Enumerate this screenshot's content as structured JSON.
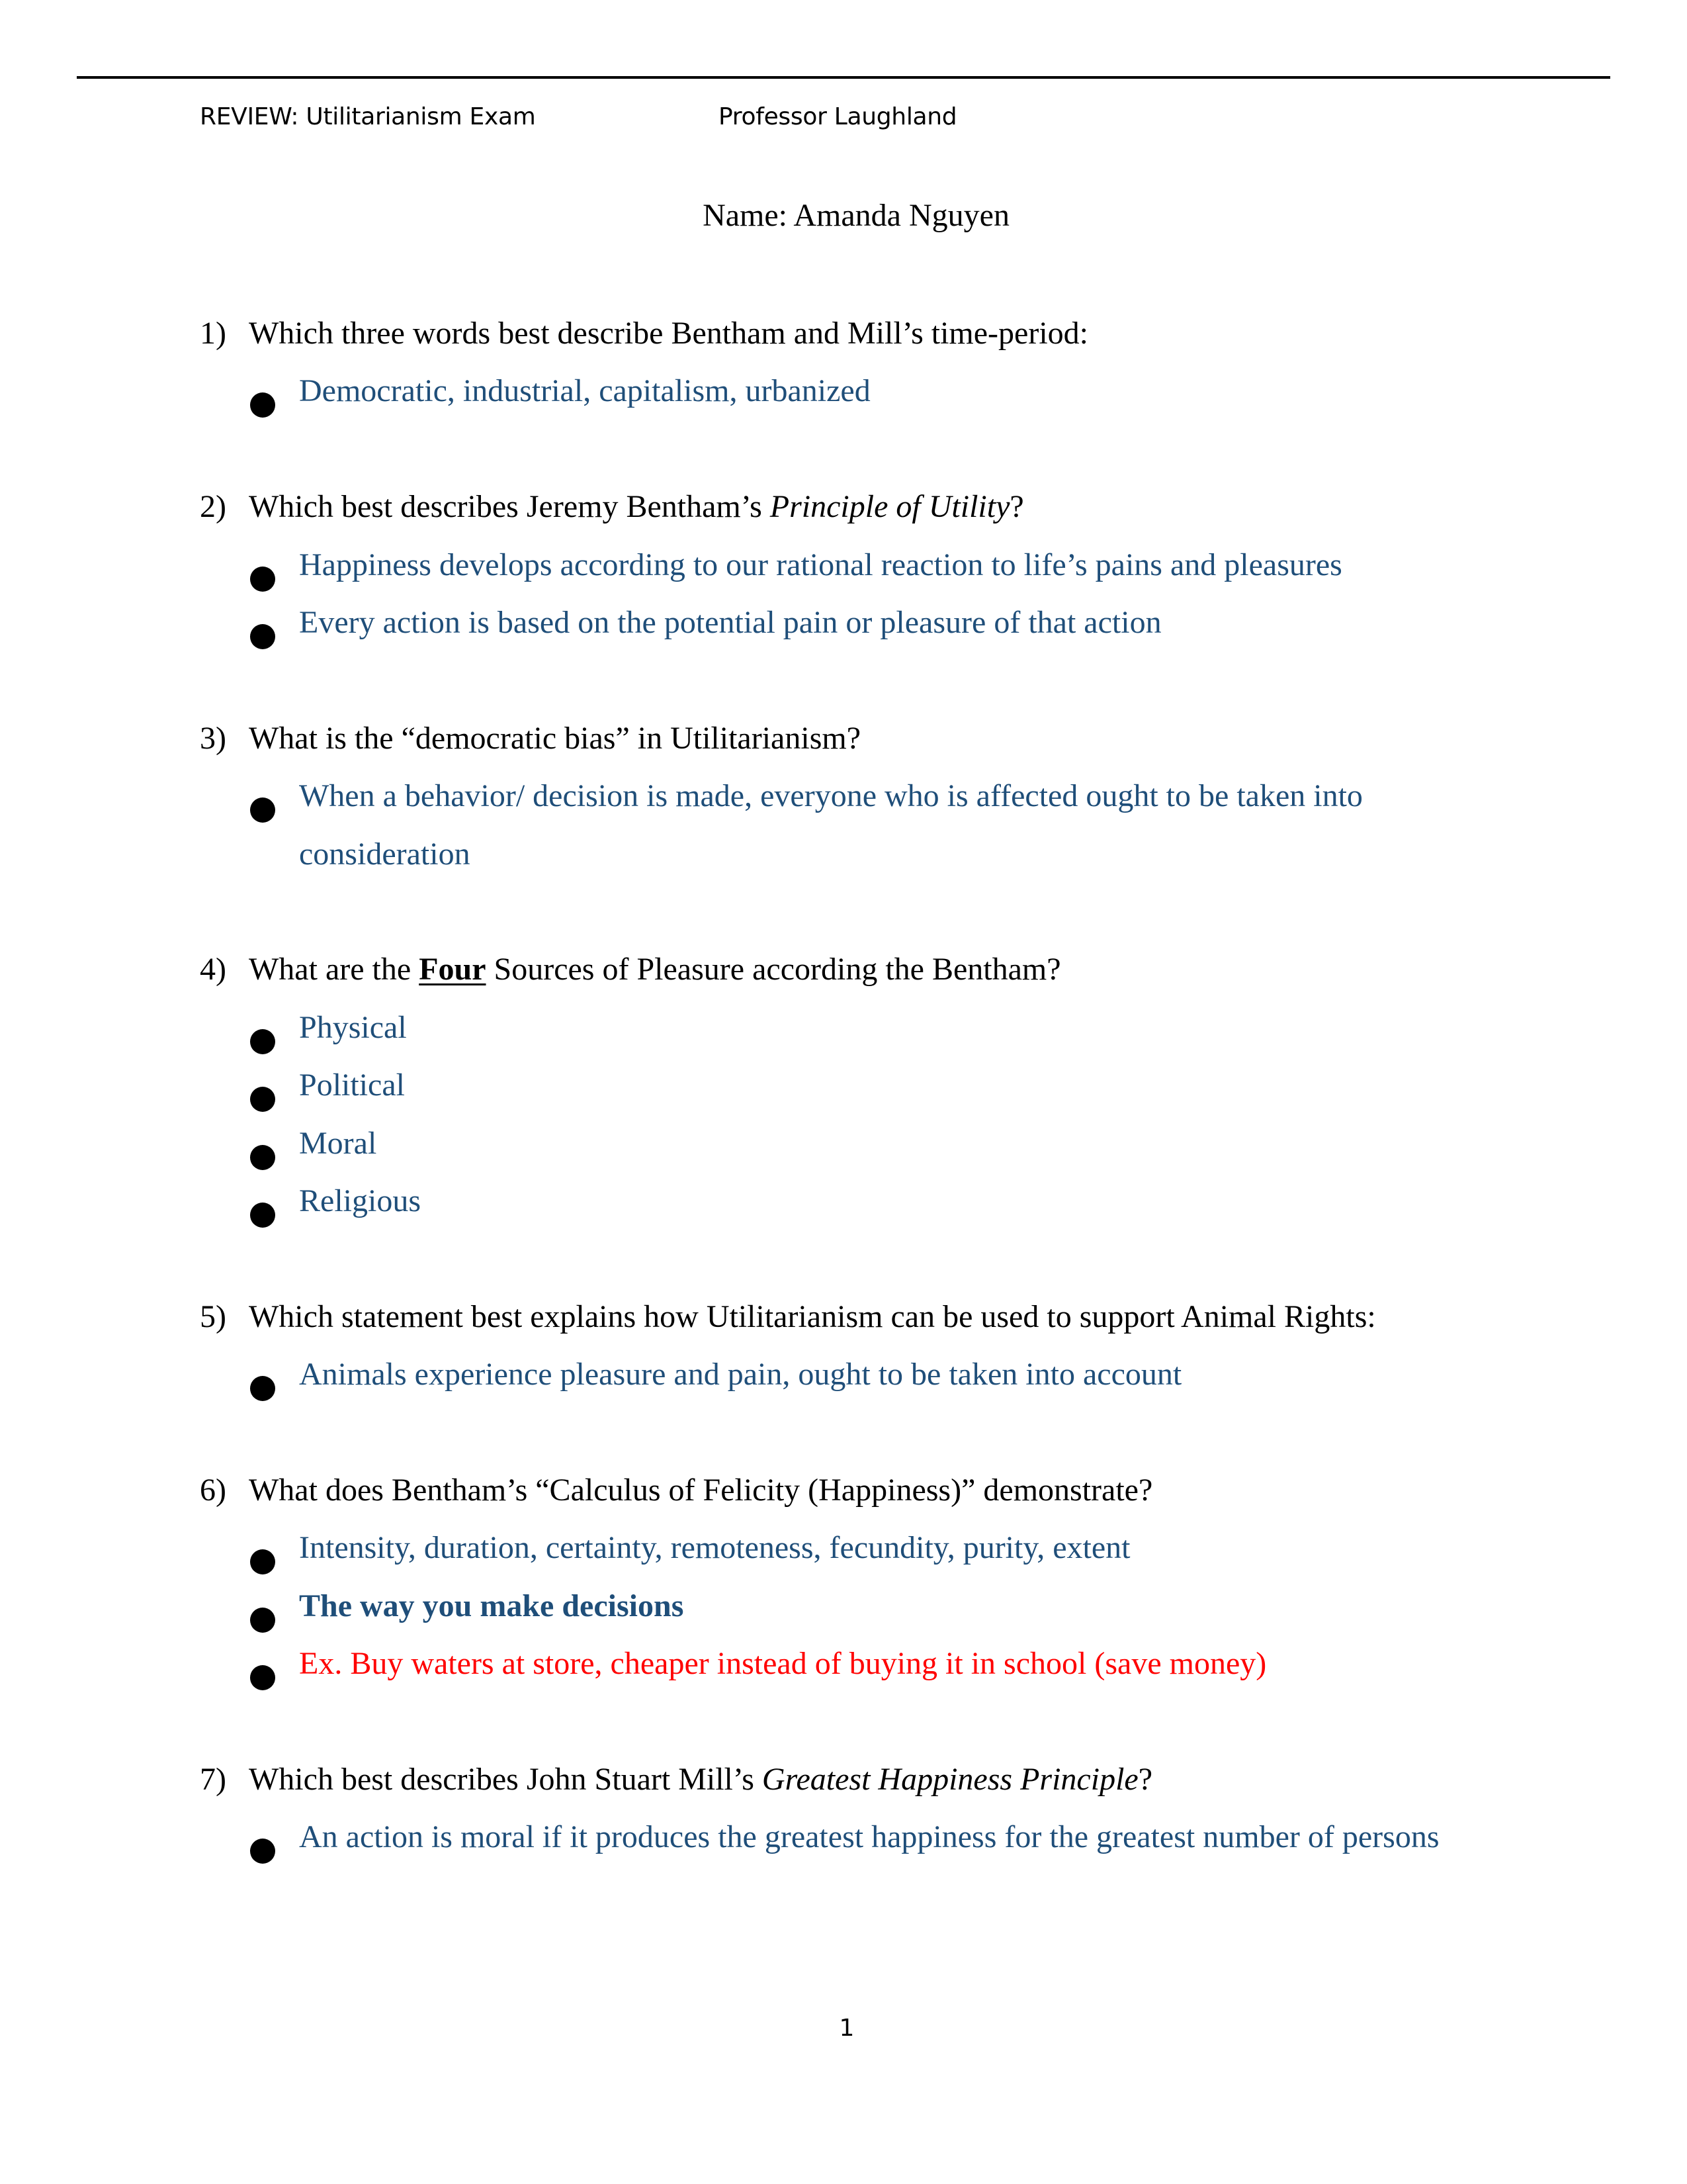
{
  "header": {
    "title": "REVIEW: Utilitarianism Exam",
    "professor": "Professor Laughland"
  },
  "student": {
    "name_line": "Name: Amanda Nguyen"
  },
  "colors": {
    "answer": "#1f4e79",
    "example": "#ff0000",
    "question": "#000000"
  },
  "questions": [
    {
      "number": "1)",
      "text_parts": [
        {
          "text": "Which three words best describe Bentham and Mill’s time-period:",
          "style": "normal"
        }
      ],
      "answers": [
        {
          "text": "Democratic, industrial, capitalism, urbanized",
          "style": "normal"
        }
      ]
    },
    {
      "number": "2)",
      "text_parts": [
        {
          "text": "Which best describes Jeremy Bentham’s ",
          "style": "normal"
        },
        {
          "text": "Principle of Utility",
          "style": "italic"
        },
        {
          "text": "?",
          "style": "normal"
        }
      ],
      "answers": [
        {
          "text": "Happiness develops according to our rational reaction to life’s pains and pleasures",
          "style": "normal"
        },
        {
          "text": "Every action is based on the potential pain or pleasure of that action",
          "style": "normal"
        }
      ]
    },
    {
      "number": "3)",
      "text_parts": [
        {
          "text": "What is the “democratic bias” in Utilitarianism?",
          "style": "normal"
        }
      ],
      "answers": [
        {
          "text": "When a behavior/ decision is made, everyone who is affected ought to be taken into",
          "continuation": "consideration",
          "style": "normal"
        }
      ]
    },
    {
      "number": "4)",
      "text_parts": [
        {
          "text": "What are the ",
          "style": "normal"
        },
        {
          "text": "Four",
          "style": "bold-underline"
        },
        {
          "text": " Sources of Pleasure according the Bentham?",
          "style": "normal"
        }
      ],
      "answers": [
        {
          "text": "Physical",
          "style": "normal"
        },
        {
          "text": "Political",
          "style": "normal"
        },
        {
          "text": "Moral",
          "style": "normal"
        },
        {
          "text": "Religious",
          "style": "normal"
        }
      ]
    },
    {
      "number": "5)",
      "text_parts": [
        {
          "text": "Which statement best explains how Utilitarianism can be used to support Animal Rights:",
          "style": "normal"
        }
      ],
      "answers": [
        {
          "text": "Animals experience pleasure and pain, ought to be taken into account",
          "style": "normal"
        }
      ]
    },
    {
      "number": "6)",
      "text_parts": [
        {
          "text": "What does Bentham’s  “Calculus of Felicity (Happiness)” demonstrate?",
          "style": "normal"
        }
      ],
      "answers": [
        {
          "text": "Intensity, duration, certainty, remoteness, fecundity, purity, extent",
          "style": "normal"
        },
        {
          "text": "The way you make decisions",
          "style": "bold"
        },
        {
          "text": "Ex. Buy waters at store, cheaper instead of buying it in school (save money)",
          "style": "red"
        }
      ]
    },
    {
      "number": "7)",
      "text_parts": [
        {
          "text": "Which best describes John Stuart Mill’s ",
          "style": "normal"
        },
        {
          "text": "Greatest Happiness Principle",
          "style": "italic"
        },
        {
          "text": "?",
          "style": "normal"
        }
      ],
      "answers": [
        {
          "text": "An action is moral if it produces the greatest happiness for the greatest number of persons",
          "style": "normal"
        }
      ]
    }
  ],
  "footer": {
    "page_number": "1"
  }
}
